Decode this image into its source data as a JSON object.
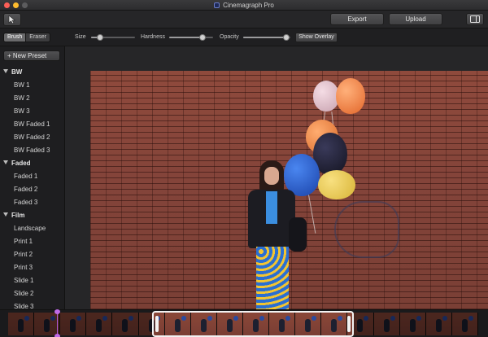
{
  "window": {
    "title": "Cinemagraph Pro"
  },
  "toolbar": {
    "export_label": "Export",
    "upload_label": "Upload",
    "select_tool_icon": "cursor-arrow-icon",
    "panel_toggle_icon": "sidebar-panel-icon"
  },
  "options": {
    "brush_label": "Brush",
    "eraser_label": "Eraser",
    "active_mode": "Brush",
    "size_label": "Size",
    "size_value": 0.2,
    "hardness_label": "Hardness",
    "hardness_value": 0.75,
    "opacity_label": "Opacity",
    "opacity_value": 0.92,
    "show_overlay_label": "Show Overlay"
  },
  "sidebar": {
    "new_preset_label": "+ New Preset",
    "groups": [
      {
        "name": "BW",
        "items": [
          "BW 1",
          "BW 2",
          "BW 3",
          "BW Faded 1",
          "BW Faded 2",
          "BW Faded 3"
        ]
      },
      {
        "name": "Faded",
        "items": [
          "Faded 1",
          "Faded 2",
          "Faded 3"
        ]
      },
      {
        "name": "Film",
        "items": [
          "Landscape",
          "Print 1",
          "Print 2",
          "Print 3",
          "Slide 1",
          "Slide 2",
          "Slide 3"
        ]
      }
    ]
  },
  "colors": {
    "accent_playhead": "#b05ad8",
    "close_button": "#fc5f57",
    "minimize_button": "#fdbc2e"
  },
  "timeline": {
    "frame_count": 18,
    "selection_start": 0.31,
    "selection_end": 0.74,
    "playhead_position": 0.1
  }
}
